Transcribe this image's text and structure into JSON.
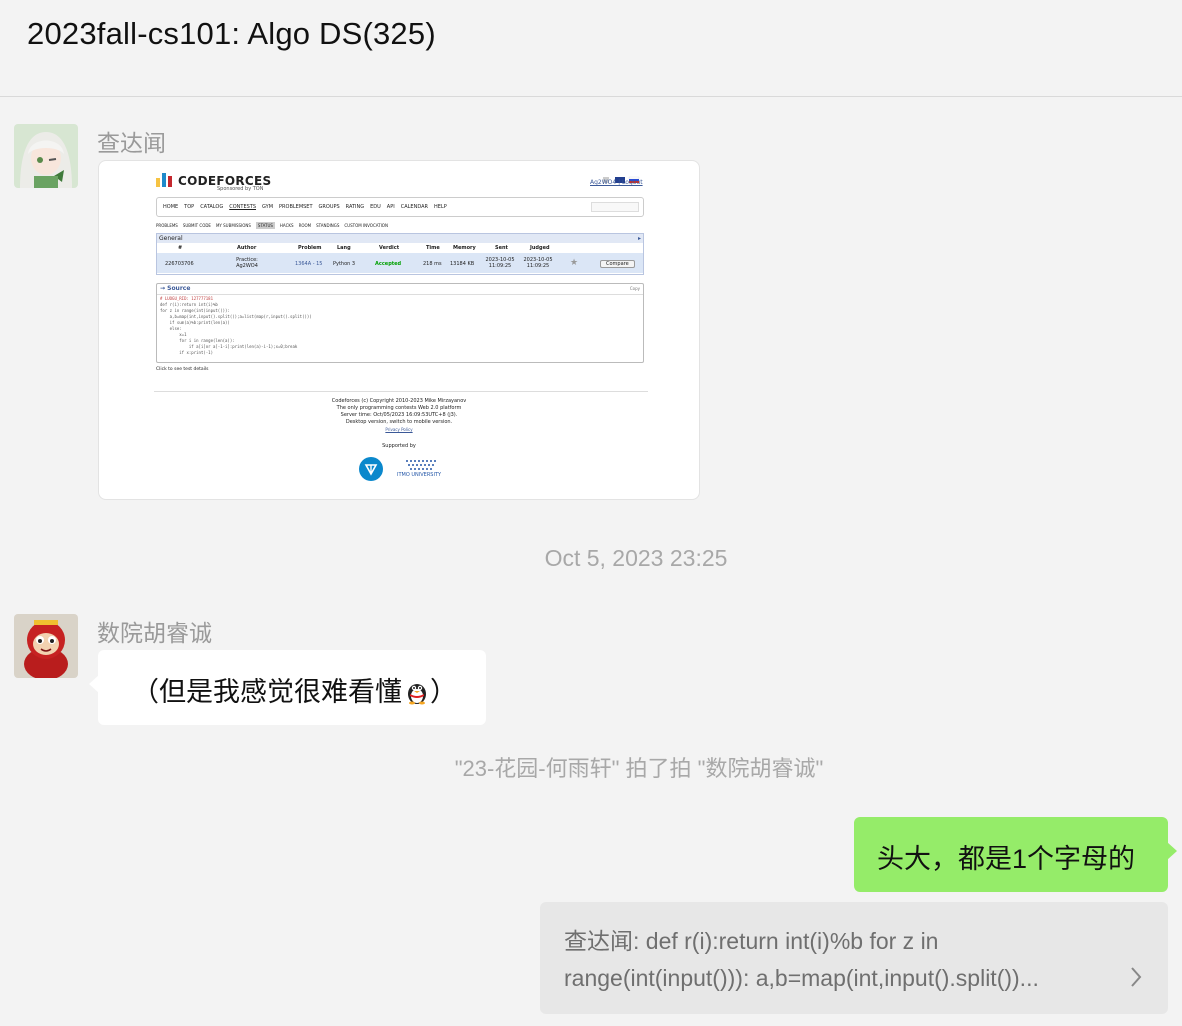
{
  "window": {
    "title": "2023fall-cs101: Algo DS(325)"
  },
  "messages": [
    {
      "sender": "查达闻",
      "type": "image"
    },
    {
      "sender": "数院胡睿诚",
      "text": "（但是我感觉很难看懂",
      "text_end": "）",
      "emoji": "qq-penguin-emoji"
    },
    {
      "text": "头大，都是1个字母的"
    }
  ],
  "timestamp": "Oct 5, 2023 23:25",
  "system_message": "\"23-花园-何雨轩\" 拍了拍 \"数院胡睿诚\"",
  "quote": {
    "line1": "查达闻: def r(i):return int(i)%b for z in",
    "line2": "range(int(input())): a,b=map(int,input().split())..."
  },
  "screenshot": {
    "logo": "CODEFORCES",
    "logo_sub": "Sponsored by TON",
    "user": "Ag2WO4 | Logout",
    "nav": [
      "HOME",
      "TOP",
      "CATALOG",
      "CONTESTS",
      "GYM",
      "PROBLEMSET",
      "GROUPS",
      "RATING",
      "EDU",
      "API",
      "CALENDAR",
      "HELP"
    ],
    "subnav": [
      "PROBLEMS",
      "SUBMIT CODE",
      "MY SUBMISSIONS",
      "STATUS",
      "HACKS",
      "ROOM",
      "STANDINGS",
      "CUSTOM INVOCATION"
    ],
    "table_title": "General",
    "headers": [
      "#",
      "Author",
      "Problem",
      "Lang",
      "Verdict",
      "Time",
      "Memory",
      "Sent",
      "Judged"
    ],
    "row": {
      "id": "226703706",
      "author": "Practice: Ag2WO4",
      "problem": "1364A - 15",
      "lang": "Python 3",
      "verdict": "Accepted",
      "time": "218 ms",
      "memory": "13184 KB",
      "sent": "2023-10-05 11:09:25",
      "judged": "2023-10-05 11:09:25",
      "compare": "Compare"
    },
    "source_title": "→ Source",
    "copy": "Copy",
    "code": [
      "# LUOGU_RID: 127777181",
      "def r(i):return int(i)%b",
      "for z in range(int(input())):",
      "    a,b=map(int,input().split());a=list(map(r,input().split()))",
      "    if sum(a)%b:print(len(a))",
      "    else:",
      "        x=1",
      "        for i in range(len(a)):",
      "            if a[i]or a[-1-i]:print(len(a)-i-1);x=0;break",
      "        if x:print(-1)"
    ],
    "click": "Click to see test details",
    "footer": [
      "Codeforces (c) Copyright 2010-2023 Mike Mirzayanov",
      "The only programming contests Web 2.0 platform",
      "Server time: Oct/05/2023 16:09:53UTC+8 (j3).",
      "Desktop version, switch to mobile version.",
      "Privacy Policy"
    ],
    "supported": "Supported by",
    "itmo": "ITMO UNIVERSITY"
  },
  "colors": {
    "green_bubble": "#95ec69",
    "cf_blue": "#3b5998",
    "accepted": "#00a000"
  }
}
